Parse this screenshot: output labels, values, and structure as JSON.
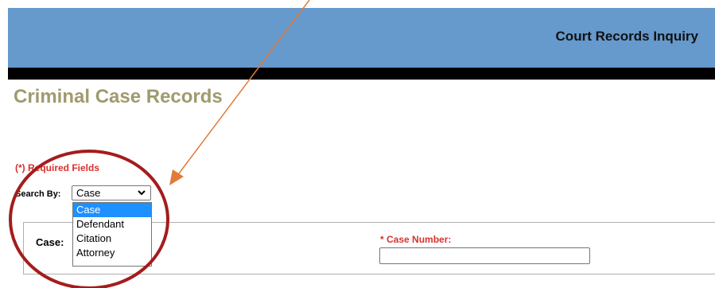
{
  "header": {
    "title": "Court Records Inquiry",
    "banner_color": "#6699cc",
    "bar_color": "#000000"
  },
  "page": {
    "title": "Criminal Case Records",
    "title_color": "#a09a6e"
  },
  "form": {
    "required_note": "(*) Required Fields",
    "required_color": "#d9302c",
    "search_by_label": "Search By:",
    "search_by_selected": "Case",
    "search_by_options": [
      "Case",
      "Defendant",
      "Citation",
      "Attorney"
    ],
    "highlighted_option_index": 0,
    "highlight_color": "#1e90ff",
    "case_label": "Case:",
    "case_number_label": "* Case Number:",
    "case_number_value": ""
  },
  "annotations": {
    "arrow_color": "#e07b39",
    "circle_color": "#a51c1c"
  }
}
